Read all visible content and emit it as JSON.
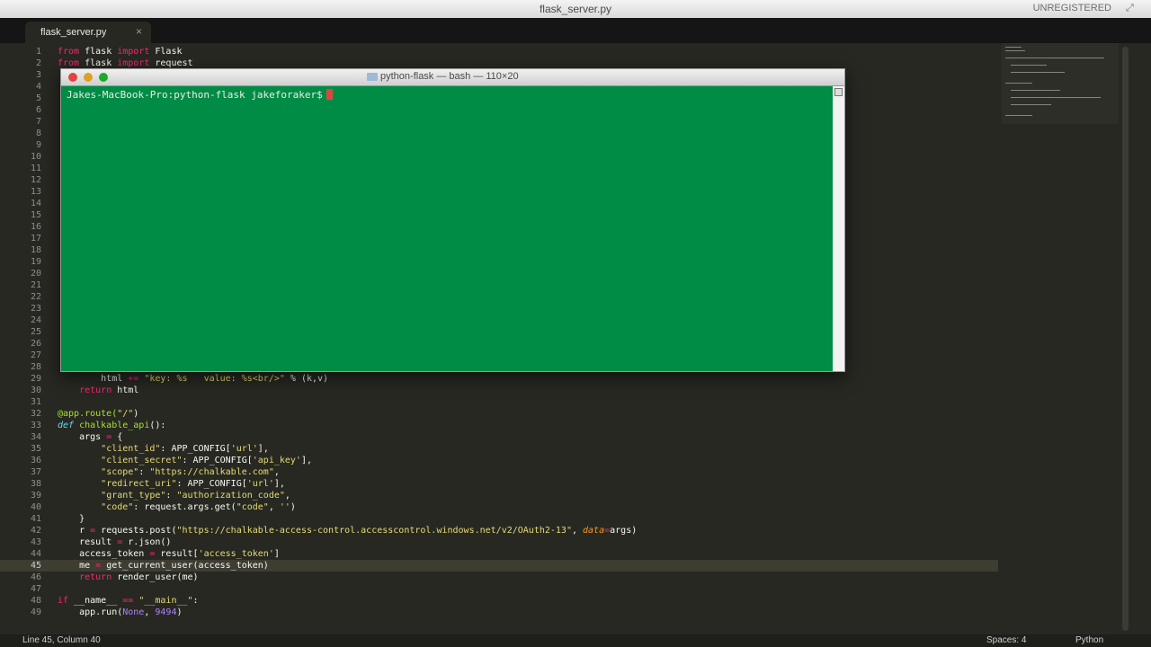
{
  "window": {
    "title": "flask_server.py",
    "unregistered": "UNREGISTERED"
  },
  "tab": {
    "label": "flask_server.py",
    "close": "×"
  },
  "editor": {
    "line_numbers": [
      "1",
      "2",
      "3",
      "4",
      "5",
      "6",
      "7",
      "8",
      "9",
      "10",
      "11",
      "12",
      "13",
      "14",
      "15",
      "16",
      "17",
      "18",
      "19",
      "20",
      "21",
      "22",
      "23",
      "24",
      "25",
      "26",
      "27",
      "28",
      "29",
      "30",
      "31",
      "32",
      "33",
      "34",
      "35",
      "36",
      "37",
      "38",
      "39",
      "40",
      "41",
      "42",
      "43",
      "44",
      "45",
      "46",
      "47",
      "48",
      "49"
    ],
    "current_line": "45",
    "code": {
      "l1": {
        "a": "from",
        "b": " flask ",
        "c": "import",
        "d": " Flask"
      },
      "l2": {
        "a": "from",
        "b": " flask ",
        "c": "import",
        "d": " request"
      },
      "l29": {
        "a": "        html ",
        "b": "+=",
        "c": " \"key: %s   value: %s<br/>\"",
        "d": " % (k,v)"
      },
      "l30": {
        "a": "    ",
        "b": "return",
        "c": " html"
      },
      "l32": {
        "a": "@app.route(",
        "b": "\"/\"",
        "c": ")"
      },
      "l33": {
        "a": "def",
        "b": " chalkable_api",
        "c": "():"
      },
      "l34": {
        "a": "    args ",
        "b": "=",
        "c": " {"
      },
      "l35": {
        "a": "        ",
        "b": "\"client_id\"",
        "c": ": APP_CONFIG[",
        "d": "'url'",
        "e": "],"
      },
      "l36": {
        "a": "        ",
        "b": "\"client_secret\"",
        "c": ": APP_CONFIG[",
        "d": "'api_key'",
        "e": "],"
      },
      "l37": {
        "a": "        ",
        "b": "\"scope\"",
        "c": ": ",
        "d": "\"https://chalkable.com\"",
        "e": ","
      },
      "l38": {
        "a": "        ",
        "b": "\"redirect_uri\"",
        "c": ": APP_CONFIG[",
        "d": "'url'",
        "e": "],"
      },
      "l39": {
        "a": "        ",
        "b": "\"grant_type\"",
        "c": ": ",
        "d": "\"authorization_code\"",
        "e": ","
      },
      "l40": {
        "a": "        ",
        "b": "\"code\"",
        "c": ": request.args.get(",
        "d": "\"code\"",
        "e": ", ",
        "f": "''",
        "g": ")"
      },
      "l41": {
        "a": "    }"
      },
      "l42": {
        "a": "    r ",
        "b": "=",
        "c": " requests.post(",
        "d": "\"https://chalkable-access-control.accesscontrol.windows.net/v2/OAuth2-13\"",
        "e": ", ",
        "f": "data",
        "g": "=",
        "h": "args)"
      },
      "l43": {
        "a": "    result ",
        "b": "=",
        "c": " r.json()"
      },
      "l44": {
        "a": "    access_token ",
        "b": "=",
        "c": " result[",
        "d": "'access_token'",
        "e": "]"
      },
      "l45": {
        "a": "    me ",
        "b": "=",
        "c": " get_current_user(access_token)"
      },
      "l46": {
        "a": "    ",
        "b": "return",
        "c": " render_user(me)"
      },
      "l48": {
        "a": "if",
        "b": " __name__ ",
        "c": "==",
        "d": " \"__main__\"",
        "e": ":"
      },
      "l49": {
        "a": "    app.run(",
        "b": "None",
        "c": ", ",
        "d": "9494",
        "e": ")"
      }
    }
  },
  "terminal": {
    "title": "python-flask — bash — 110×20",
    "prompt": "Jakes-MacBook-Pro:python-flask jakeforaker$"
  },
  "status": {
    "position": "Line 45, Column 40",
    "spaces": "Spaces: 4",
    "syntax": "Python"
  },
  "colors": {
    "editor_bg": "#272822",
    "terminal_bg": "#008c44",
    "keyword": "#f92672",
    "string": "#e6db74",
    "function": "#a6e22e"
  }
}
